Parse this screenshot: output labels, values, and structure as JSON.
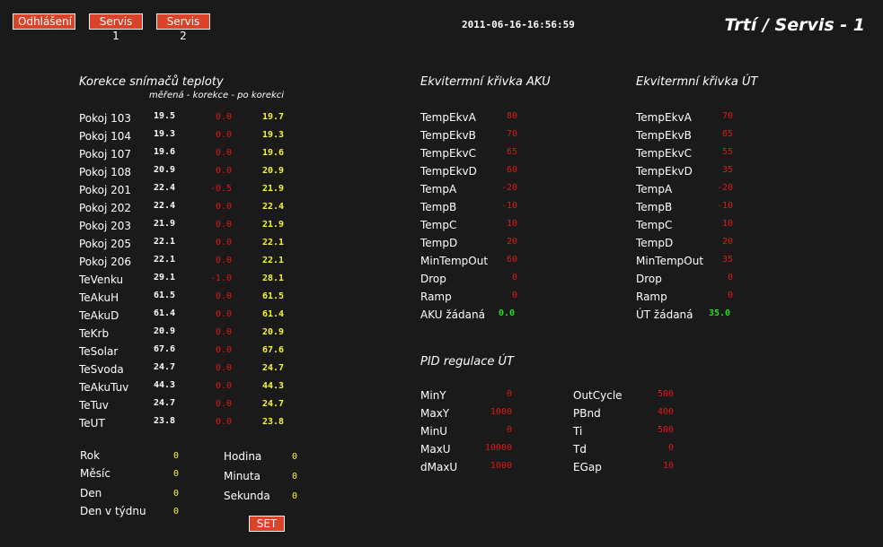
{
  "header": {
    "logout_label": "Odhlášení",
    "servis1_label": "Servis 1",
    "servis2_label": "Servis 2",
    "timestamp": "2011-06-16-16:56:59",
    "title": "Trtí / Servis - 1"
  },
  "korekce": {
    "title": "Korekce snímačů teploty",
    "subtitle": "měřená - korekce - po korekci",
    "rows": [
      {
        "name": "Pokoj 103",
        "measured": "19.5",
        "correction": "0.0",
        "corrected": "19.7"
      },
      {
        "name": "Pokoj 104",
        "measured": "19.3",
        "correction": "0.0",
        "corrected": "19.3"
      },
      {
        "name": "Pokoj 107",
        "measured": "19.6",
        "correction": "0.0",
        "corrected": "19.6"
      },
      {
        "name": "Pokoj 108",
        "measured": "20.9",
        "correction": "0.0",
        "corrected": "20.9"
      },
      {
        "name": "Pokoj 201",
        "measured": "22.4",
        "correction": "-0.5",
        "corrected": "21.9"
      },
      {
        "name": "Pokoj 202",
        "measured": "22.4",
        "correction": "0.0",
        "corrected": "22.4"
      },
      {
        "name": "Pokoj 203",
        "measured": "21.9",
        "correction": "0.0",
        "corrected": "21.9"
      },
      {
        "name": "Pokoj 205",
        "measured": "22.1",
        "correction": "0.0",
        "corrected": "22.1"
      },
      {
        "name": "Pokoj 206",
        "measured": "22.1",
        "correction": "0.0",
        "corrected": "22.1"
      },
      {
        "name": "TeVenku",
        "measured": "29.1",
        "correction": "-1.0",
        "corrected": "28.1"
      },
      {
        "name": "TeAkuH",
        "measured": "61.5",
        "correction": "0.0",
        "corrected": "61.5"
      },
      {
        "name": "TeAkuD",
        "measured": "61.4",
        "correction": "0.0",
        "corrected": "61.4"
      },
      {
        "name": "TeKrb",
        "measured": "20.9",
        "correction": "0.0",
        "corrected": "20.9"
      },
      {
        "name": "TeSolar",
        "measured": "67.6",
        "correction": "0.0",
        "corrected": "67.6"
      },
      {
        "name": "TeSvoda",
        "measured": "24.7",
        "correction": "0.0",
        "corrected": "24.7"
      },
      {
        "name": "TeAkuTuv",
        "measured": "44.3",
        "correction": "0.0",
        "corrected": "44.3"
      },
      {
        "name": "TeTuv",
        "measured": "24.7",
        "correction": "0.0",
        "corrected": "24.7"
      },
      {
        "name": "TeUT",
        "measured": "23.8",
        "correction": "0.0",
        "corrected": "23.8"
      }
    ]
  },
  "datetime": {
    "left": [
      {
        "label": "Rok",
        "value": "0"
      },
      {
        "label": "Měsíc",
        "value": "0"
      },
      {
        "label": "Den",
        "value": "0"
      },
      {
        "label": "Den v týdnu",
        "value": "0"
      }
    ],
    "right": [
      {
        "label": "Hodina",
        "value": "0"
      },
      {
        "label": "Minuta",
        "value": "0"
      },
      {
        "label": "Sekunda",
        "value": "0"
      }
    ],
    "set_label": "SET"
  },
  "aku": {
    "title": "Ekvitermní křivka AKU",
    "rows": [
      {
        "label": "TempEkvA",
        "value": "80"
      },
      {
        "label": "TempEkvB",
        "value": "70"
      },
      {
        "label": "TempEkvC",
        "value": "65"
      },
      {
        "label": "TempEkvD",
        "value": "60"
      },
      {
        "label": "TempA",
        "value": "-20"
      },
      {
        "label": "TempB",
        "value": "-10"
      },
      {
        "label": "TempC",
        "value": "10"
      },
      {
        "label": "TempD",
        "value": "20"
      },
      {
        "label": "MinTempOut",
        "value": "60"
      },
      {
        "label": "Drop",
        "value": "0"
      },
      {
        "label": "Ramp",
        "value": "0"
      }
    ],
    "result_label": "AKU žádaná",
    "result_value": "0.0"
  },
  "ut": {
    "title": "Ekvitermní křivka ÚT",
    "rows": [
      {
        "label": "TempEkvA",
        "value": "70"
      },
      {
        "label": "TempEkvB",
        "value": "65"
      },
      {
        "label": "TempEkvC",
        "value": "55"
      },
      {
        "label": "TempEkvD",
        "value": "35"
      },
      {
        "label": "TempA",
        "value": "-20"
      },
      {
        "label": "TempB",
        "value": "-10"
      },
      {
        "label": "TempC",
        "value": "10"
      },
      {
        "label": "TempD",
        "value": "20"
      },
      {
        "label": "MinTempOut",
        "value": "35"
      },
      {
        "label": "Drop",
        "value": "0"
      },
      {
        "label": "Ramp",
        "value": "0"
      }
    ],
    "result_label": "ÚT žádaná",
    "result_value": "35.0"
  },
  "pid": {
    "title": "PID regulace ÚT",
    "left": [
      {
        "label": "MinY",
        "value": "0"
      },
      {
        "label": "MaxY",
        "value": "1000"
      },
      {
        "label": "MinU",
        "value": "0"
      },
      {
        "label": "MaxU",
        "value": "10000"
      },
      {
        "label": "dMaxU",
        "value": "1000"
      }
    ],
    "right": [
      {
        "label": "OutCycle",
        "value": "500"
      },
      {
        "label": "PBnd",
        "value": "400"
      },
      {
        "label": "Ti",
        "value": "500"
      },
      {
        "label": "Td",
        "value": "0"
      },
      {
        "label": "EGap",
        "value": "10"
      }
    ]
  }
}
